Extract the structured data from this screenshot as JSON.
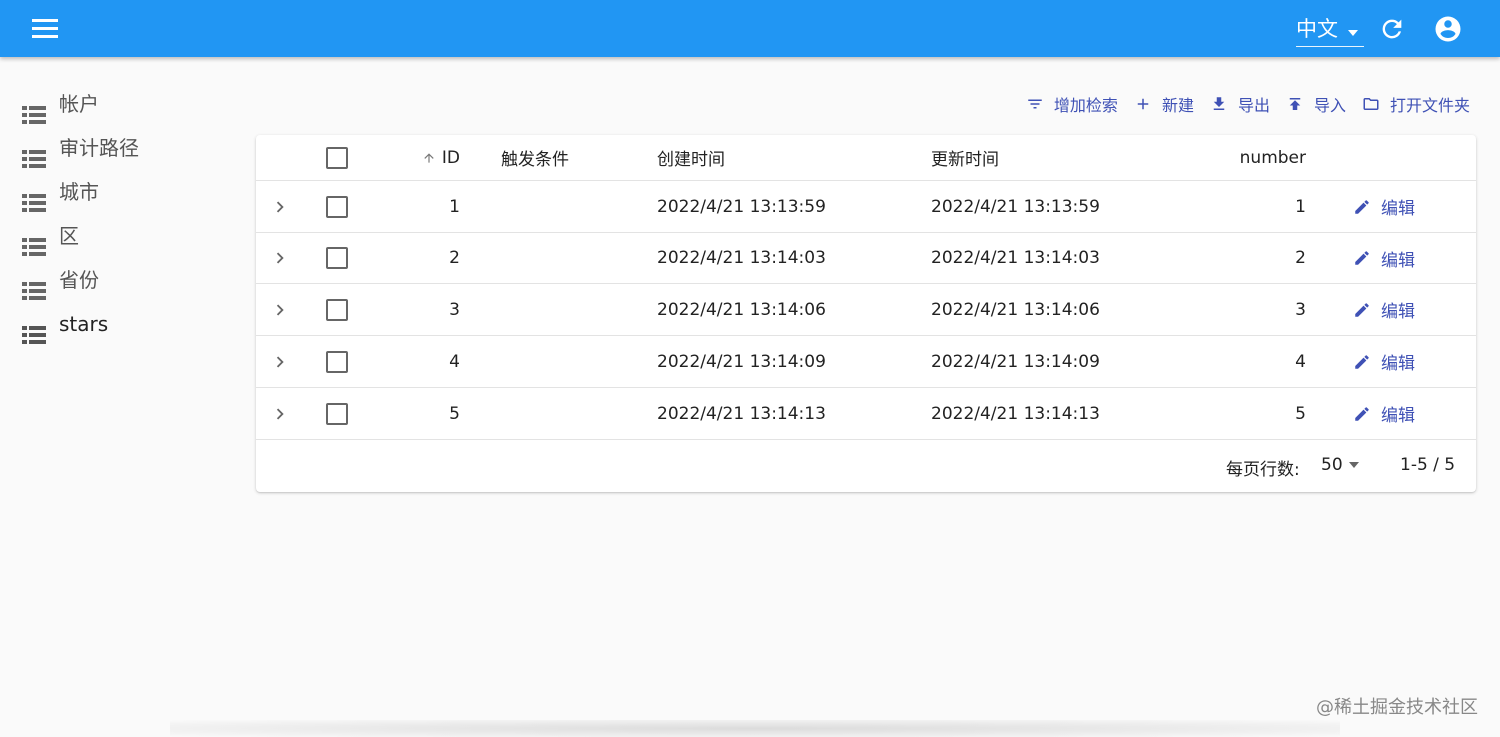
{
  "header": {
    "language": "中文",
    "menu_icon": "menu-icon",
    "refresh_icon": "refresh-icon",
    "account_icon": "account-circle-icon",
    "bg_color": "#2196f3"
  },
  "sidebar": {
    "items": [
      {
        "label": "帐户",
        "icon": "list-icon"
      },
      {
        "label": "审计路径",
        "icon": "list-icon"
      },
      {
        "label": "城市",
        "icon": "list-icon"
      },
      {
        "label": "区",
        "icon": "list-icon"
      },
      {
        "label": "省份",
        "icon": "list-icon"
      },
      {
        "label": "stars",
        "icon": "list-icon"
      }
    ]
  },
  "toolbar": {
    "add_filter": "增加检索",
    "create": "新建",
    "export": "导出",
    "import": "导入",
    "open_folder": "打开文件夹",
    "accent_color": "#3f51b5"
  },
  "table": {
    "columns": {
      "id": "ID",
      "trigger": "触发条件",
      "created_at": "创建时间",
      "updated_at": "更新时间",
      "number": "number"
    },
    "edit_label": "编辑",
    "rows": [
      {
        "id": "1",
        "trigger": "",
        "created_at": "2022/4/21 13:13:59",
        "updated_at": "2022/4/21 13:13:59",
        "number": "1"
      },
      {
        "id": "2",
        "trigger": "",
        "created_at": "2022/4/21 13:14:03",
        "updated_at": "2022/4/21 13:14:03",
        "number": "2"
      },
      {
        "id": "3",
        "trigger": "",
        "created_at": "2022/4/21 13:14:06",
        "updated_at": "2022/4/21 13:14:06",
        "number": "3"
      },
      {
        "id": "4",
        "trigger": "",
        "created_at": "2022/4/21 13:14:09",
        "updated_at": "2022/4/21 13:14:09",
        "number": "4"
      },
      {
        "id": "5",
        "trigger": "",
        "created_at": "2022/4/21 13:14:13",
        "updated_at": "2022/4/21 13:14:13",
        "number": "5"
      }
    ]
  },
  "pagination": {
    "rows_per_page_label": "每页行数:",
    "rows_per_page_value": "50",
    "range": "1-5 / 5"
  },
  "watermark": "@稀土掘金技术社区"
}
